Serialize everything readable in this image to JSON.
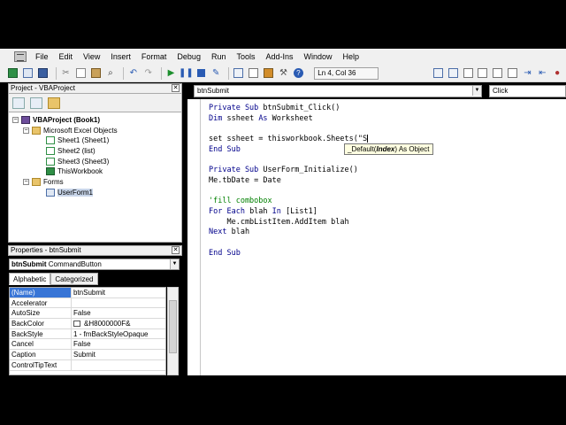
{
  "menu": {
    "items": [
      "File",
      "Edit",
      "View",
      "Insert",
      "Format",
      "Debug",
      "Run",
      "Tools",
      "Add-Ins",
      "Window",
      "Help"
    ]
  },
  "toolbar": {
    "status": "Ln 4, Col 36",
    "icons": [
      "excel-icon",
      "insert-icon",
      "save-icon",
      "cut-icon",
      "copy-icon",
      "paste-icon",
      "find-icon",
      "undo-icon",
      "redo-icon",
      "run-icon",
      "break-icon",
      "reset-icon",
      "design-mode-icon",
      "project-explorer-icon",
      "properties-icon",
      "object-browser-icon",
      "toolbox-icon",
      "help-icon"
    ]
  },
  "project": {
    "title": "Project - VBAProject",
    "root": "VBAProject (Book1)",
    "excel_objects": "Microsoft Excel Objects",
    "sheets": [
      "Sheet1 (Sheet1)",
      "Sheet2 (list)",
      "Sheet3 (Sheet3)",
      "ThisWorkbook"
    ],
    "forms_folder": "Forms",
    "forms": [
      "UserForm1"
    ]
  },
  "properties": {
    "title": "Properties - btnSubmit",
    "object_name": "btnSubmit",
    "object_type": "CommandButton",
    "tabs": [
      "Alphabetic",
      "Categorized"
    ],
    "rows": [
      {
        "key": "(Name)",
        "value": "btnSubmit"
      },
      {
        "key": "Accelerator",
        "value": ""
      },
      {
        "key": "AutoSize",
        "value": "False"
      },
      {
        "key": "BackColor",
        "value": "&H8000000F&"
      },
      {
        "key": "BackStyle",
        "value": "1 - fmBackStyleOpaque"
      },
      {
        "key": "Cancel",
        "value": "False"
      },
      {
        "key": "Caption",
        "value": "Submit"
      },
      {
        "key": "ControlTipText",
        "value": ""
      }
    ]
  },
  "editor": {
    "object_combo": "btnSubmit",
    "proc_combo": "Click",
    "lines": {
      "l1a": "Private Sub ",
      "l1b": "btnSubmit_Click()",
      "l2a": "Dim ",
      "l2b": "ssheet ",
      "l2c": "As ",
      "l2d": "Worksheet",
      "l4a": "set ",
      "l4b": "ssheet = thisworkbook.Sheets(\"S",
      "l5": "End Sub",
      "l7a": "Private Sub ",
      "l7b": "UserForm_Initialize()",
      "l8": "Me.tbDate = Date",
      "l10": "'fill combobox",
      "l11a": "For Each ",
      "l11b": "blah ",
      "l11c": "In ",
      "l11d": "[List1]",
      "l12": "    Me.cmbListItem.AddItem blah",
      "l13a": "Next ",
      "l13b": "blah",
      "l15": "End Sub"
    },
    "tooltip": {
      "prefix": "_Default(",
      "param": "Index",
      "suffix": ") As Object"
    }
  }
}
